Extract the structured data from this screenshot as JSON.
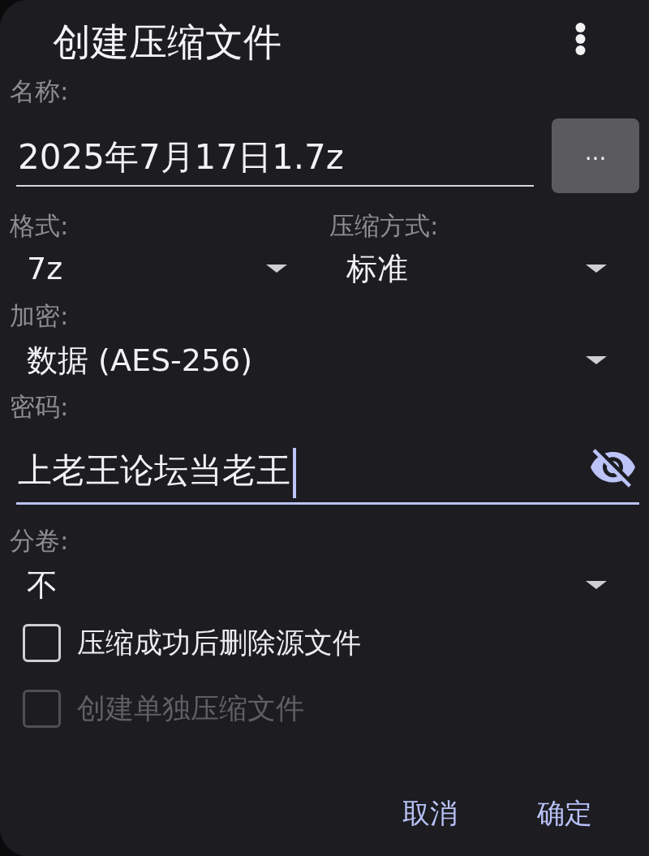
{
  "dialog": {
    "title": "创建压缩文件"
  },
  "name": {
    "label": "名称:",
    "value": "2025年7月17日1.7z",
    "button": "..."
  },
  "format": {
    "label": "格式:",
    "value": "7z"
  },
  "compression_method": {
    "label": "压缩方式:",
    "value": "标准"
  },
  "encryption": {
    "label": "加密:",
    "value": "数据 (AES-256)"
  },
  "password": {
    "label": "密码:",
    "value": "上老王论坛当老王",
    "focused": true
  },
  "split_volume": {
    "label": "分卷:",
    "value": "不"
  },
  "options": [
    {
      "label": "压缩成功后删除源文件",
      "checked": false,
      "disabled": false
    },
    {
      "label": "创建单独压缩文件",
      "checked": false,
      "disabled": true
    }
  ],
  "buttons": [
    {
      "label": "取消"
    },
    {
      "label": "确定"
    }
  ]
}
